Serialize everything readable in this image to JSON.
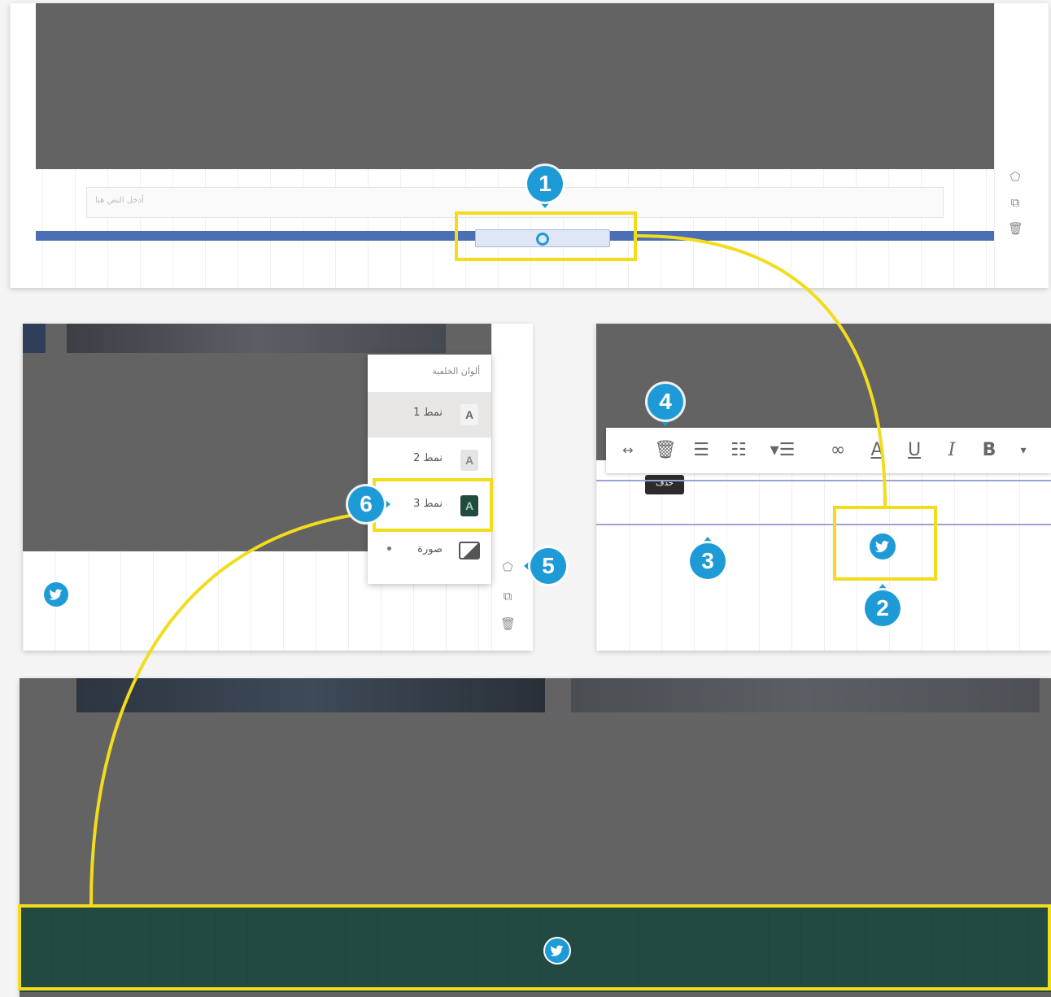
{
  "markers": {
    "m1": "1",
    "m2": "2",
    "m3": "3",
    "m4": "4",
    "m5": "5",
    "m6": "6"
  },
  "style_menu": {
    "title": "ألوان الخلفية",
    "items": [
      {
        "label": "نمط 1",
        "swatch": "A"
      },
      {
        "label": "نمط 2",
        "swatch": "A"
      },
      {
        "label": "نمط 3",
        "swatch": "A"
      },
      {
        "label": "صورة",
        "swatch_icon": "image-icon"
      }
    ]
  },
  "toolbar": {
    "tooltip": "حذف",
    "bold": "B",
    "italic": "I",
    "underline": "U"
  },
  "top_panel": {
    "input_placeholder": "أدخل النص هنا"
  },
  "colors": {
    "accent_yellow": "#f2dc1b",
    "marker_blue": "#1e9bd7",
    "footer_green": "#234a40",
    "dark_bg": "#636363",
    "divider_blue": "#4a6fb5"
  }
}
